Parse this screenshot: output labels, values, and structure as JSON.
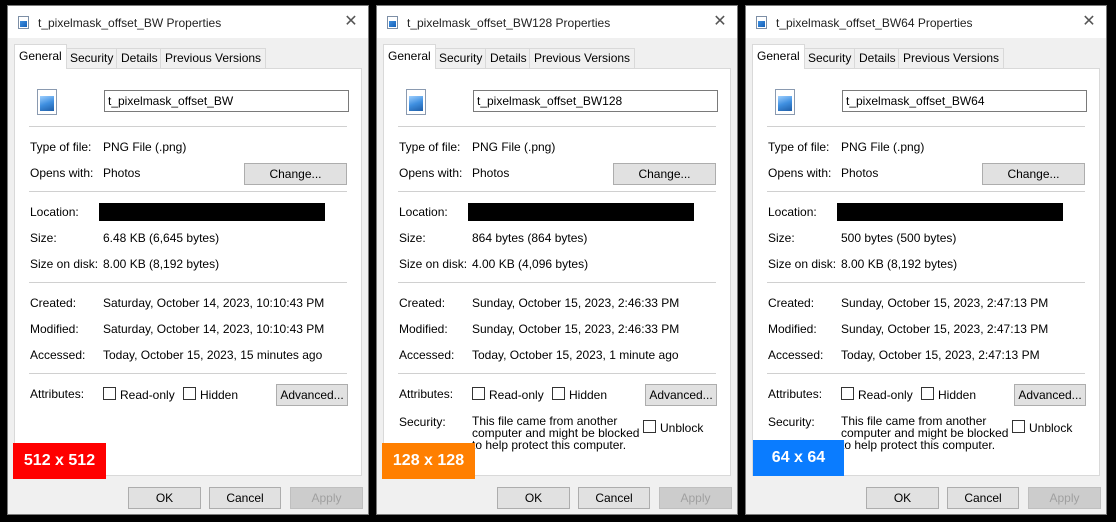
{
  "windows": [
    {
      "title": "t_pixelmask_offset_BW Properties",
      "tabs": [
        "General",
        "Security",
        "Details",
        "Previous Versions"
      ],
      "filename": "t_pixelmask_offset_BW",
      "type_label": "Type of file:",
      "type_value": "PNG File (.png)",
      "opens_label": "Opens with:",
      "opens_value": "Photos",
      "change_label": "Change...",
      "location_label": "Location:",
      "size_label": "Size:",
      "size_value": "6.48 KB (6,645 bytes)",
      "disk_label": "Size on disk:",
      "disk_value": "8.00 KB (8,192 bytes)",
      "created_label": "Created:",
      "created_value": "Saturday, October 14, 2023, 10:10:43 PM",
      "modified_label": "Modified:",
      "modified_value": "Saturday, October 14, 2023, 10:10:43 PM",
      "accessed_label": "Accessed:",
      "accessed_value": "Today, October 15, 2023, 15 minutes ago",
      "attributes_label": "Attributes:",
      "readonly_label": "Read-only",
      "hidden_label": "Hidden",
      "advanced_label": "Advanced...",
      "ok_label": "OK",
      "cancel_label": "Cancel",
      "apply_label": "Apply",
      "badge": "512 x 512",
      "badge_color": "#ff0000"
    },
    {
      "title": "t_pixelmask_offset_BW128 Properties",
      "tabs": [
        "General",
        "Security",
        "Details",
        "Previous Versions"
      ],
      "filename": "t_pixelmask_offset_BW128",
      "type_label": "Type of file:",
      "type_value": "PNG File (.png)",
      "opens_label": "Opens with:",
      "opens_value": "Photos",
      "change_label": "Change...",
      "location_label": "Location:",
      "size_label": "Size:",
      "size_value": "864 bytes (864 bytes)",
      "disk_label": "Size on disk:",
      "disk_value": "4.00 KB (4,096 bytes)",
      "created_label": "Created:",
      "created_value": "Sunday, October 15, 2023, 2:46:33 PM",
      "modified_label": "Modified:",
      "modified_value": "Sunday, October 15, 2023, 2:46:33 PM",
      "accessed_label": "Accessed:",
      "accessed_value": "Today, October 15, 2023, 1 minute ago",
      "attributes_label": "Attributes:",
      "readonly_label": "Read-only",
      "hidden_label": "Hidden",
      "advanced_label": "Advanced...",
      "security_label": "Security:",
      "security_text": "This file came from another computer and might be blocked to help protect this computer.",
      "unblock_label": "Unblock",
      "ok_label": "OK",
      "cancel_label": "Cancel",
      "apply_label": "Apply",
      "badge": "128 x 128",
      "badge_color": "#ff7f00"
    },
    {
      "title": "t_pixelmask_offset_BW64 Properties",
      "tabs": [
        "General",
        "Security",
        "Details",
        "Previous Versions"
      ],
      "filename": "t_pixelmask_offset_BW64",
      "type_label": "Type of file:",
      "type_value": "PNG File (.png)",
      "opens_label": "Opens with:",
      "opens_value": "Photos",
      "change_label": "Change...",
      "location_label": "Location:",
      "size_label": "Size:",
      "size_value": "500 bytes (500 bytes)",
      "disk_label": "Size on disk:",
      "disk_value": "8.00 KB (8,192 bytes)",
      "created_label": "Created:",
      "created_value": "Sunday, October 15, 2023, 2:47:13 PM",
      "modified_label": "Modified:",
      "modified_value": "Sunday, October 15, 2023, 2:47:13 PM",
      "accessed_label": "Accessed:",
      "accessed_value": "Today, October 15, 2023, 2:47:13 PM",
      "attributes_label": "Attributes:",
      "readonly_label": "Read-only",
      "hidden_label": "Hidden",
      "advanced_label": "Advanced...",
      "security_label": "Security:",
      "security_text": "This file came from another computer and might be blocked to help protect this computer.",
      "unblock_label": "Unblock",
      "ok_label": "OK",
      "cancel_label": "Cancel",
      "apply_label": "Apply",
      "badge": "64 x 64",
      "badge_color": "#0a7cff"
    }
  ]
}
